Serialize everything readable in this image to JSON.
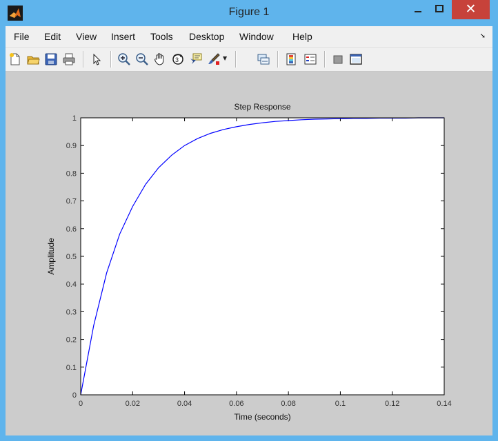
{
  "window": {
    "title": "Figure 1",
    "close_glyph": "✕"
  },
  "menu": [
    "File",
    "Edit",
    "View",
    "Insert",
    "Tools",
    "Desktop",
    "Window",
    "Help"
  ],
  "toolbar_icons": [
    "new-figure-icon",
    "open-file-icon",
    "save-icon",
    "print-icon",
    "edit-plot-arrow-icon",
    "zoom-in-icon",
    "zoom-out-icon",
    "pan-hand-icon",
    "rotate-3d-icon",
    "data-cursor-icon",
    "brush-icon",
    "link-plot-icon",
    "insert-colorbar-icon",
    "insert-legend-icon",
    "hide-plot-tools-icon",
    "show-plot-tools-icon"
  ],
  "colors": {
    "titlebar": "#5fb4ec",
    "close": "#c7423a",
    "figure_bg": "#cccccc",
    "line": "#0000ff"
  },
  "chart_data": {
    "type": "line",
    "title": "Step Response",
    "xlabel": "Time (seconds)",
    "ylabel": "Amplitude",
    "xlim": [
      0,
      0.14
    ],
    "ylim": [
      0,
      1
    ],
    "xticks": [
      "0",
      "0.02",
      "0.04",
      "0.06",
      "0.08",
      "0.1",
      "0.12",
      "0.14"
    ],
    "yticks": [
      "0",
      "0.1",
      "0.2",
      "0.3",
      "0.4",
      "0.5",
      "0.6",
      "0.7",
      "0.8",
      "0.9",
      "1"
    ],
    "grid": false,
    "reference_line": {
      "y": 1,
      "style": "dashed"
    },
    "series": [
      {
        "x": [
          0,
          0.005,
          0.01,
          0.015,
          0.02,
          0.025,
          0.03,
          0.035,
          0.04,
          0.045,
          0.05,
          0.055,
          0.06,
          0.065,
          0.07,
          0.075,
          0.08,
          0.085,
          0.09,
          0.095,
          0.1,
          0.105,
          0.11,
          0.115,
          0.12,
          0.125,
          0.13
        ],
        "y": [
          0,
          0.25,
          0.44,
          0.58,
          0.68,
          0.76,
          0.82,
          0.865,
          0.9,
          0.925,
          0.944,
          0.958,
          0.968,
          0.976,
          0.982,
          0.987,
          0.99,
          0.993,
          0.995,
          0.996,
          0.997,
          0.998,
          0.998,
          0.999,
          0.999,
          0.999,
          1.0
        ]
      }
    ]
  }
}
